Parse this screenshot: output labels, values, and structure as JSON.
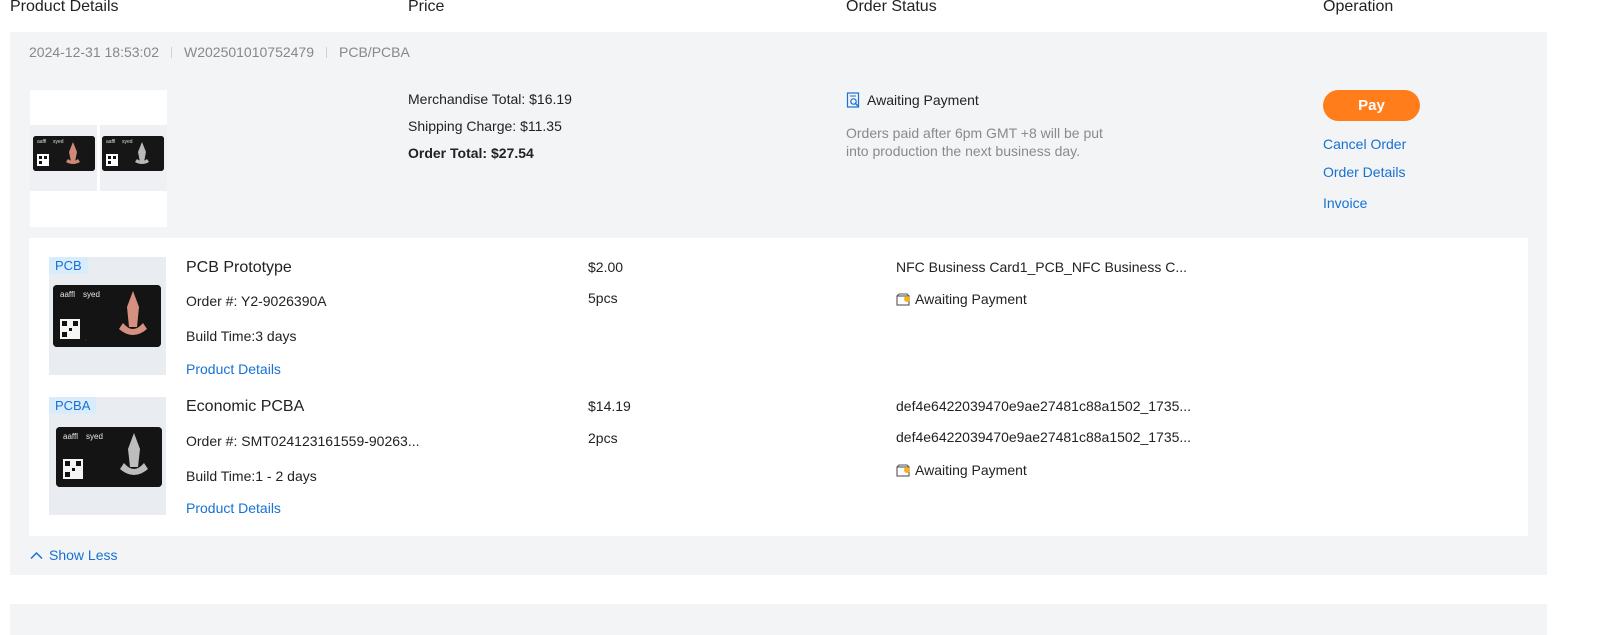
{
  "columns": {
    "product": "Product Details",
    "price": "Price",
    "status": "Order Status",
    "operation": "Operation"
  },
  "order": {
    "datetime": "2024-12-31 18:53:02",
    "order_no": "W202501010752479",
    "category": "PCB/PCBA",
    "merchandise_total": "Merchandise Total: $16.19",
    "shipping_charge": "Shipping Charge: $11.35",
    "order_total": "Order Total: $27.54",
    "status": "Awaiting Payment",
    "status_note": "Orders paid after 6pm GMT +8 will be put into production the next business day.",
    "operations": {
      "pay": "Pay",
      "cancel": "Cancel Order",
      "details": "Order Details",
      "invoice": "Invoice"
    },
    "items": [
      {
        "tag": "PCB",
        "name": "PCB Prototype",
        "order_no": "Order #: Y2-9026390A",
        "build_time": "Build Time:3 days",
        "details_link": "Product Details",
        "price": "$2.00",
        "qty": "5pcs",
        "files": [
          "NFC Business Card1_PCB_NFC Business C..."
        ],
        "status": "Awaiting Payment"
      },
      {
        "tag": "PCBA",
        "name": "Economic PCBA",
        "order_no": "Order #: SMT024123161559-90263...",
        "build_time": "Build Time:1 - 2 days",
        "details_link": "Product Details",
        "price": "$14.19",
        "qty": "2pcs",
        "files": [
          "def4e6422039470e9ae27481c88a1502_1735...",
          "def4e6422039470e9ae27481c88a1502_1735..."
        ],
        "status": "Awaiting Payment"
      }
    ],
    "show_less": "Show Less"
  },
  "card_text": {
    "brand": "aaffl",
    "name": "syed"
  },
  "colors": {
    "accent": "#ff7d1a",
    "link": "#1671d4",
    "panel": "#f3f4f6"
  },
  "icons": {
    "status": "search-document-icon",
    "item_status": "wallet-icon",
    "collapse": "chevron-up-icon"
  }
}
